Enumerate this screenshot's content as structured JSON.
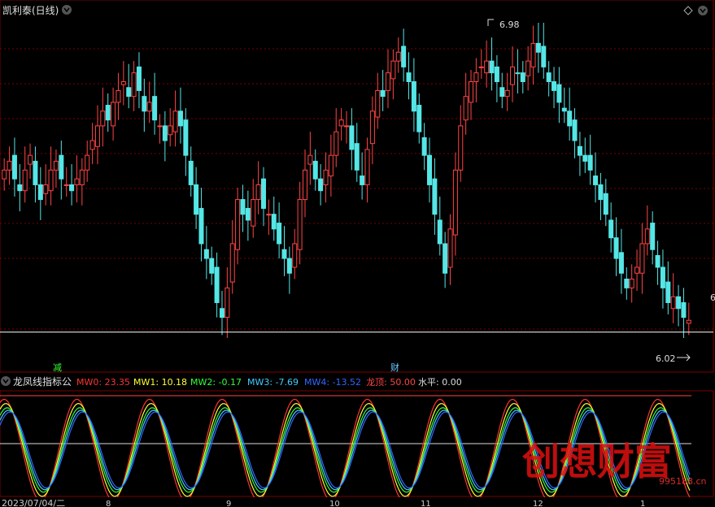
{
  "title": "凯利泰(日线)",
  "indicator_title": "龙凤线指标公",
  "legend": [
    {
      "key": "MW0",
      "value": "23.35",
      "color": "#ff3333"
    },
    {
      "key": "MW1",
      "value": "10.18",
      "color": "#ffff33"
    },
    {
      "key": "MW2",
      "value": "-0.17",
      "color": "#33ff33"
    },
    {
      "key": "MW3",
      "value": "-7.69",
      "color": "#44ccff"
    },
    {
      "key": "MW4",
      "value": "-13.52",
      "color": "#3366ff"
    },
    {
      "key": "龙顶",
      "value": "50.00",
      "color": "#ff4444"
    },
    {
      "key": "水平",
      "value": "0.00",
      "color": "#dddddd"
    }
  ],
  "markers": {
    "jian": "减",
    "cai": "财"
  },
  "axis": {
    "date_start": "2023/07/04/二",
    "months": [
      "8",
      "9",
      "10",
      "11",
      "12",
      "1"
    ],
    "right_tick": "6"
  },
  "watermark": {
    "text": "创想财富",
    "url": "995188.cn"
  },
  "colors": {
    "up": "#ff4444",
    "down": "#55e6e6",
    "grid": "#7a0000",
    "hline": "#ffffff"
  },
  "chart_data": [
    {
      "type": "candlestick",
      "title": "凯利泰(日线)",
      "ylim": [
        5.9,
        7.05
      ],
      "high_annotation": 6.98,
      "low_annotation": 6.02,
      "reference_line": 6.0,
      "closes": [
        6.55,
        6.58,
        6.52,
        6.48,
        6.55,
        6.6,
        6.5,
        6.45,
        6.5,
        6.55,
        6.58,
        6.52,
        6.5,
        6.48,
        6.52,
        6.55,
        6.6,
        6.65,
        6.7,
        6.75,
        6.72,
        6.78,
        6.82,
        6.85,
        6.8,
        6.88,
        6.82,
        6.75,
        6.78,
        6.72,
        6.7,
        6.65,
        6.7,
        6.75,
        6.7,
        6.6,
        6.5,
        6.4,
        6.3,
        6.25,
        6.2,
        6.1,
        6.05,
        6.15,
        6.3,
        6.45,
        6.4,
        6.38,
        6.45,
        6.5,
        6.42,
        6.4,
        6.35,
        6.3,
        6.25,
        6.2,
        6.3,
        6.45,
        6.55,
        6.6,
        6.52,
        6.48,
        6.55,
        6.6,
        6.68,
        6.72,
        6.7,
        6.62,
        6.55,
        6.5,
        6.62,
        6.75,
        6.82,
        6.8,
        6.88,
        6.92,
        6.95,
        6.9,
        6.85,
        6.75,
        6.68,
        6.6,
        6.5,
        6.4,
        6.3,
        6.2,
        6.35,
        6.55,
        6.7,
        6.8,
        6.85,
        6.88,
        6.9,
        6.92,
        6.88,
        6.85,
        6.8,
        6.82,
        6.9,
        6.88,
        6.85,
        6.92,
        6.98,
        6.95,
        6.9,
        6.85,
        6.82,
        6.78,
        6.75,
        6.7,
        6.65,
        6.6,
        6.58,
        6.55,
        6.5,
        6.45,
        6.4,
        6.32,
        6.25,
        6.2,
        6.15,
        6.18,
        6.22,
        6.3,
        6.35,
        6.28,
        6.22,
        6.15,
        6.1,
        6.12,
        6.08,
        6.05,
        6.04
      ]
    },
    {
      "type": "line",
      "title": "龙凤线指标公",
      "ylim": [
        -60,
        65
      ],
      "reference_lines": [
        {
          "name": "龙顶",
          "value": 50
        },
        {
          "name": "水平",
          "value": 0
        }
      ],
      "period": 14,
      "series": [
        {
          "name": "MW0",
          "phase": 0.0,
          "amplitude": 60
        },
        {
          "name": "MW1",
          "phase": 0.3,
          "amplitude": 55
        },
        {
          "name": "MW2",
          "phase": 0.55,
          "amplitude": 50
        },
        {
          "name": "MW3",
          "phase": 0.8,
          "amplitude": 47
        },
        {
          "name": "MW4",
          "phase": 1.1,
          "amplitude": 45
        }
      ]
    }
  ]
}
